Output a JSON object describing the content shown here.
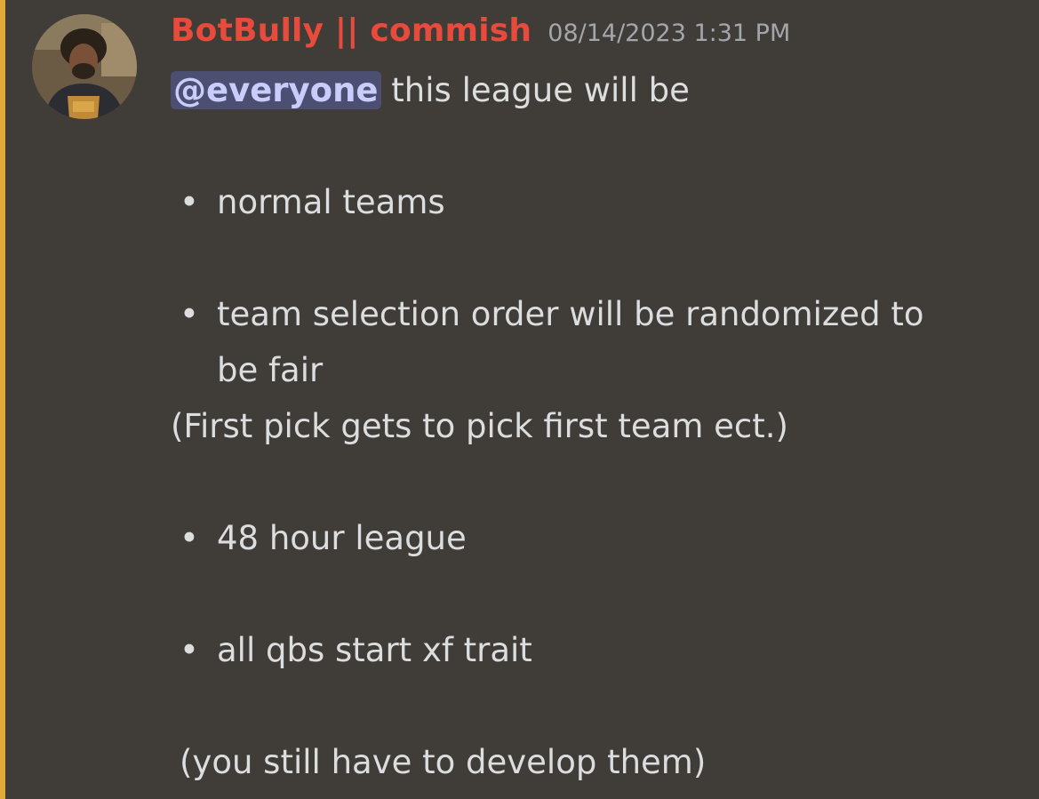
{
  "message": {
    "avatar_icon": "user-avatar-photo",
    "author": "BotBully || commish",
    "author_color": "#e84b3c",
    "timestamp": "08/14/2023 1:31 PM",
    "mention": "@everyone",
    "intro_text": " this league will be",
    "bullets": [
      "normal teams",
      "team selection order will be randomized to",
      "48 hour league",
      "all qbs start xf trait"
    ],
    "bullet_2_continuation": "be fair",
    "note_1": "(First pick gets to pick first team ect.)",
    "note_2": "(you still have to develop them)"
  },
  "colors": {
    "background": "#403d39",
    "highlight_bar": "#e0a93a",
    "mention_bg": "#4d4f72",
    "mention_text": "#c9cdfb",
    "timestamp": "#a3a6aa",
    "body_text": "#dcddde"
  }
}
